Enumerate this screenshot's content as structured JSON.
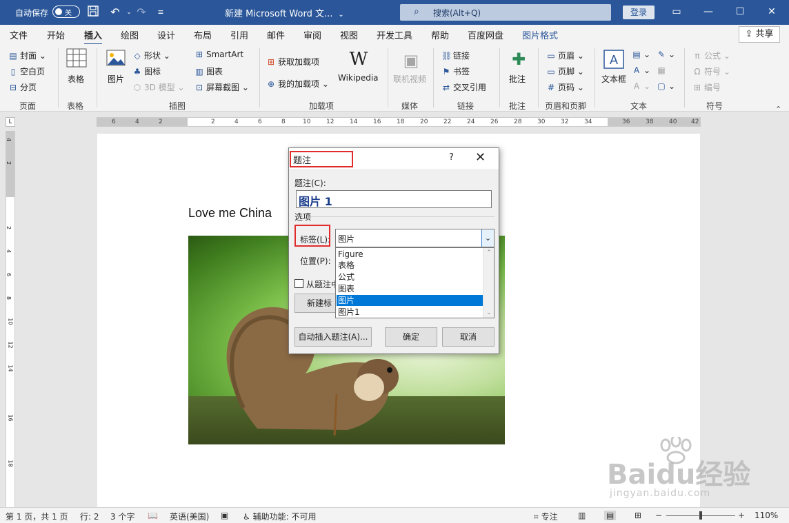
{
  "titlebar": {
    "autosave_label": "自动保存",
    "autosave_state": "关",
    "doc_title": "新建 Microsoft Word 文...",
    "search_placeholder": "搜索(Alt+Q)",
    "login_label": "登录",
    "icons": [
      "save-icon",
      "undo-icon",
      "redo-icon",
      "customize-icon",
      "ribbon-display-icon",
      "minimize-icon",
      "maximize-icon",
      "close-icon"
    ]
  },
  "menu": {
    "tabs": [
      "文件",
      "开始",
      "插入",
      "绘图",
      "设计",
      "布局",
      "引用",
      "邮件",
      "审阅",
      "视图",
      "开发工具",
      "帮助",
      "百度网盘",
      "图片格式"
    ],
    "active_tab": "插入",
    "share_label": "共享"
  },
  "ribbon": {
    "pages": {
      "label": "页面",
      "items": [
        "封面",
        "空白页",
        "分页"
      ]
    },
    "tables": {
      "label": "表格",
      "items": [
        "表格"
      ]
    },
    "illustrations": {
      "label": "插图",
      "items": [
        "图片",
        "形状",
        "图标",
        "3D 模型",
        "SmartArt",
        "图表",
        "屏幕截图"
      ]
    },
    "addins": {
      "label": "加载项",
      "items": [
        "获取加载项",
        "我的加载项",
        "Wikipedia"
      ]
    },
    "media": {
      "label": "媒体",
      "items": [
        "联机视频"
      ]
    },
    "links": {
      "label": "链接",
      "items": [
        "链接",
        "书签",
        "交叉引用"
      ]
    },
    "comments": {
      "label": "批注",
      "items": [
        "批注"
      ]
    },
    "header_footer": {
      "label": "页眉和页脚",
      "items": [
        "页眉",
        "页脚",
        "页码"
      ]
    },
    "text": {
      "label": "文本",
      "items": [
        "文本框"
      ]
    },
    "symbols": {
      "label": "符号",
      "items": [
        "公式",
        "符号",
        "编号"
      ]
    }
  },
  "ruler": {
    "h_ticks": [
      "6",
      "4",
      "2",
      "2",
      "4",
      "6",
      "8",
      "10",
      "12",
      "14",
      "16",
      "18",
      "20",
      "22",
      "24",
      "26",
      "28",
      "30",
      "32",
      "34",
      "36",
      "38",
      "40",
      "42"
    ],
    "v_ticks": [
      "4",
      "2",
      "2",
      "4",
      "6",
      "8",
      "10",
      "12",
      "14",
      "16",
      "18"
    ],
    "corner": "L"
  },
  "document": {
    "text": "Love me China"
  },
  "dialog": {
    "title": "题注",
    "help": "?",
    "caption_label": "题注(C):",
    "caption_value": "图片 1",
    "options_label": "选项",
    "label_label": "标签(L):",
    "label_selected": "图片",
    "label_options": [
      "Figure",
      "表格",
      "公式",
      "图表",
      "图片",
      "图片1"
    ],
    "label_options_selected_index": 4,
    "position_label": "位置(P):",
    "exclude_label": "从题注中",
    "new_label_btn": "新建标签",
    "autoinsert_btn": "自动插入题注(A)...",
    "ok_btn": "确定",
    "cancel_btn": "取消",
    "highlight_color": "#e12b2b"
  },
  "statusbar": {
    "page": "第 1 页，共 1 页",
    "line": "行: 2",
    "words": "3 个字",
    "language": "英语(美国)",
    "accessibility": "辅助功能: 不可用",
    "focus": "专注",
    "zoom": "110%"
  },
  "watermark": {
    "logo": "Baidu经验",
    "url": "jingyan.baidu.com"
  },
  "colors": {
    "titlebar": "#2b579a",
    "accent": "#2b579a",
    "selection": "#0078d7"
  }
}
